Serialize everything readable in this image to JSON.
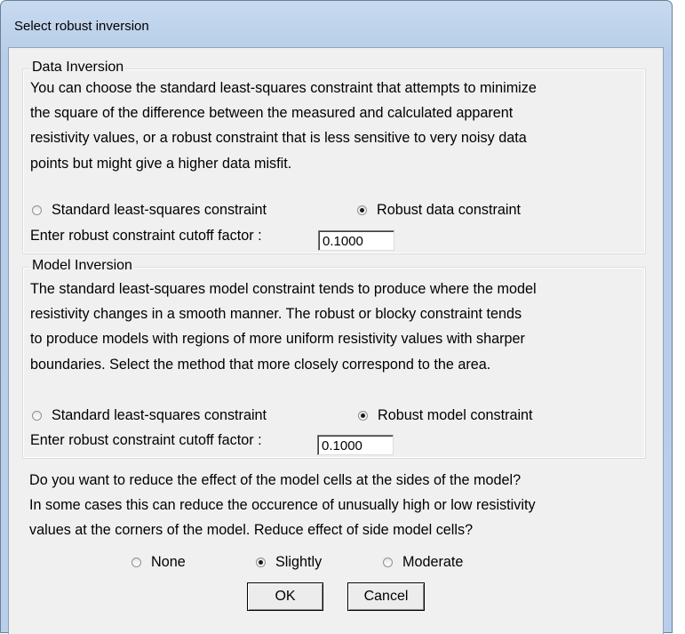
{
  "window": {
    "title": "Select robust inversion"
  },
  "data_inversion": {
    "title": "Data Inversion",
    "lines": [
      "You can choose the standard least-squares constraint that attempts to minimize",
      "the square of the difference between the measured and calculated apparent",
      "resistivity values, or a robust constraint that is less sensitive to very noisy data",
      "points but might give a higher data misfit."
    ],
    "option_standard": "Standard least-squares constraint",
    "option_robust": "Robust data constraint",
    "selected": "robust",
    "cutoff_label": "Enter robust constraint cutoff factor :",
    "cutoff_value": "0.1000"
  },
  "model_inversion": {
    "title": "Model Inversion",
    "lines": [
      "The standard least-squares model constraint tends to produce where the model",
      "resistivity changes in a smooth manner. The robust or blocky constraint tends",
      "to produce models with regions of more uniform resistivity values with sharper",
      "boundaries. Select the method that more closely correspond to the area."
    ],
    "option_standard": "Standard least-squares constraint",
    "option_robust": "Robust model constraint",
    "selected": "robust",
    "cutoff_label": "Enter robust constraint cutoff factor :",
    "cutoff_value": "0.1000"
  },
  "side_cells": {
    "lines": [
      "Do you want to reduce the effect of the model cells at the sides of the model?",
      "In some cases this can reduce the occurence of unusually high or low resistivity",
      "values at the corners of the model. Reduce effect of side model cells?"
    ],
    "option_none": "None",
    "option_slightly": "Slightly",
    "option_moderate": "Moderate",
    "selected": "slightly"
  },
  "buttons": {
    "ok": "OK",
    "cancel": "Cancel"
  }
}
